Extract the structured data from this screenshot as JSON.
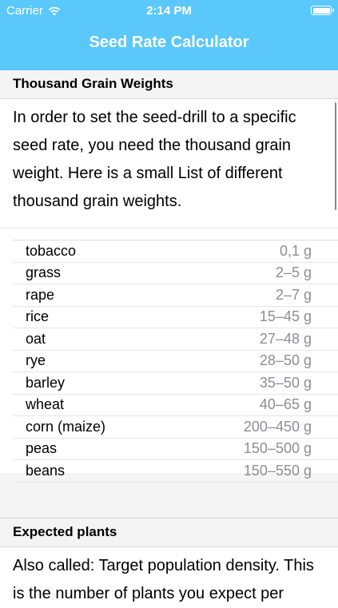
{
  "status_bar": {
    "carrier": "Carrier",
    "time": "2:14 PM",
    "icons": [
      "wifi-icon",
      "battery-icon"
    ]
  },
  "nav": {
    "title": "Seed Rate Calculator",
    "color": "#5ac8fa"
  },
  "section1": {
    "title": "Thousand Grain Weights",
    "text": "In order to set the seed-drill to a specific seed rate, you need the thousand grain weight. Here is a small List of different thousand grain weights.",
    "weights": [
      {
        "name": "tobacco",
        "value": "0,1 g"
      },
      {
        "name": "grass",
        "value": "2–5 g"
      },
      {
        "name": "rape",
        "value": "2–7 g"
      },
      {
        "name": "rice",
        "value": "15–45 g"
      },
      {
        "name": "oat",
        "value": "27–48 g"
      },
      {
        "name": "rye",
        "value": "28–50 g"
      },
      {
        "name": "barley",
        "value": "35–50 g"
      },
      {
        "name": "wheat",
        "value": "40–65 g"
      },
      {
        "name": "corn (maize)",
        "value": "200–450 g"
      },
      {
        "name": "peas",
        "value": "150–500 g"
      },
      {
        "name": "beans",
        "value": "150–550 g"
      }
    ]
  },
  "section2": {
    "title": "Expected plants",
    "text": "Also called: Target population density. This is the number of plants you expect per"
  }
}
